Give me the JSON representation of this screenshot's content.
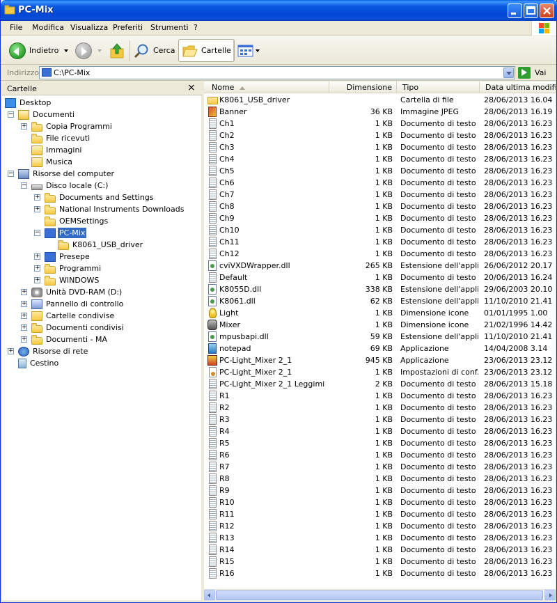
{
  "window": {
    "title": "PC-Mix"
  },
  "menu": [
    "File",
    "Modifica",
    "Visualizza",
    "Preferiti",
    "Strumenti",
    "?"
  ],
  "toolbar": {
    "back_label": "Indietro",
    "search_label": "Cerca",
    "folders_label": "Cartelle"
  },
  "address": {
    "label": "Indirizzo",
    "value": "C:\\PC-Mix",
    "go_label": "Vai"
  },
  "folders_pane": {
    "title": "Cartelle",
    "close_glyph": "×",
    "tree": [
      {
        "label": "Desktop",
        "icon": "desktop-icon",
        "depth": 0,
        "expander": ""
      },
      {
        "label": "Documenti",
        "icon": "documents-icon",
        "depth": 1,
        "expander": "−"
      },
      {
        "label": "Copia Programmi",
        "icon": "folder-icon",
        "depth": 2,
        "expander": "+"
      },
      {
        "label": "File ricevuti",
        "icon": "folder-icon",
        "depth": 2,
        "expander": ""
      },
      {
        "label": "Immagini",
        "icon": "documents-icon",
        "depth": 2,
        "expander": ""
      },
      {
        "label": "Musica",
        "icon": "documents-icon",
        "depth": 2,
        "expander": ""
      },
      {
        "label": "Risorse del computer",
        "icon": "computer-icon",
        "depth": 1,
        "expander": "−"
      },
      {
        "label": "Disco locale (C:)",
        "icon": "drive-icon",
        "depth": 2,
        "expander": "−"
      },
      {
        "label": "Documents and Settings",
        "icon": "folder-icon",
        "depth": 3,
        "expander": "+"
      },
      {
        "label": "National Instruments Downloads",
        "icon": "folder-icon",
        "depth": 3,
        "expander": "+"
      },
      {
        "label": "OEMSettings",
        "icon": "folder-icon",
        "depth": 3,
        "expander": ""
      },
      {
        "label": "PC-Mix",
        "icon": "pcmix-folder-icon",
        "depth": 3,
        "expander": "−",
        "selected": true
      },
      {
        "label": "K8061_USB_driver",
        "icon": "folder-icon",
        "depth": 4,
        "expander": ""
      },
      {
        "label": "Presepe",
        "icon": "pcmix-folder-icon",
        "depth": 3,
        "expander": "+"
      },
      {
        "label": "Programmi",
        "icon": "folder-icon",
        "depth": 3,
        "expander": "+"
      },
      {
        "label": "WINDOWS",
        "icon": "folder-icon",
        "depth": 3,
        "expander": "+"
      },
      {
        "label": "Unità DVD-RAM (D:)",
        "icon": "dvd-icon",
        "depth": 2,
        "expander": "+"
      },
      {
        "label": "Pannello di controllo",
        "icon": "control-panel-icon",
        "depth": 2,
        "expander": "+"
      },
      {
        "label": "Cartelle condivise",
        "icon": "shared-folders-icon",
        "depth": 2,
        "expander": "+"
      },
      {
        "label": "Documenti condivisi",
        "icon": "folder-icon",
        "depth": 2,
        "expander": "+"
      },
      {
        "label": "Documenti - MA",
        "icon": "folder-icon",
        "depth": 2,
        "expander": "+"
      },
      {
        "label": "Risorse di rete",
        "icon": "network-icon",
        "depth": 1,
        "expander": "+"
      },
      {
        "label": "Cestino",
        "icon": "recycle-bin-icon",
        "depth": 1,
        "expander": ""
      }
    ]
  },
  "files_pane": {
    "columns": [
      "Nome",
      "Dimensione",
      "Tipo",
      "Data ultima modifica"
    ],
    "files": [
      {
        "name": "K8061_USB_driver",
        "size": "",
        "type": "Cartella di file",
        "date": "28/06/2013 16.04",
        "icon": "folder"
      },
      {
        "name": "Banner",
        "size": "36 KB",
        "type": "Immagine JPEG",
        "date": "28/06/2013 16.19",
        "icon": "jpg"
      },
      {
        "name": "Ch1",
        "size": "1 KB",
        "type": "Documento di testo",
        "date": "28/06/2013 16.23",
        "icon": "text"
      },
      {
        "name": "Ch2",
        "size": "1 KB",
        "type": "Documento di testo",
        "date": "28/06/2013 16.23",
        "icon": "text"
      },
      {
        "name": "Ch3",
        "size": "1 KB",
        "type": "Documento di testo",
        "date": "28/06/2013 16.23",
        "icon": "text"
      },
      {
        "name": "Ch4",
        "size": "1 KB",
        "type": "Documento di testo",
        "date": "28/06/2013 16.23",
        "icon": "text"
      },
      {
        "name": "Ch5",
        "size": "1 KB",
        "type": "Documento di testo",
        "date": "28/06/2013 16.23",
        "icon": "text"
      },
      {
        "name": "Ch6",
        "size": "1 KB",
        "type": "Documento di testo",
        "date": "28/06/2013 16.23",
        "icon": "text"
      },
      {
        "name": "Ch7",
        "size": "1 KB",
        "type": "Documento di testo",
        "date": "28/06/2013 16.23",
        "icon": "text"
      },
      {
        "name": "Ch8",
        "size": "1 KB",
        "type": "Documento di testo",
        "date": "28/06/2013 16.23",
        "icon": "text"
      },
      {
        "name": "Ch9",
        "size": "1 KB",
        "type": "Documento di testo",
        "date": "28/06/2013 16.23",
        "icon": "text"
      },
      {
        "name": "Ch10",
        "size": "1 KB",
        "type": "Documento di testo",
        "date": "28/06/2013 16.23",
        "icon": "text"
      },
      {
        "name": "Ch11",
        "size": "1 KB",
        "type": "Documento di testo",
        "date": "28/06/2013 16.23",
        "icon": "text"
      },
      {
        "name": "Ch12",
        "size": "1 KB",
        "type": "Documento di testo",
        "date": "28/06/2013 16.23",
        "icon": "text"
      },
      {
        "name": "cviVXDWrapper.dll",
        "size": "265 KB",
        "type": "Estensione dell'appli...",
        "date": "26/06/2012 20.17",
        "icon": "dll"
      },
      {
        "name": "Default",
        "size": "1 KB",
        "type": "Documento di testo",
        "date": "20/06/2013 16.24",
        "icon": "text"
      },
      {
        "name": "K8055D.dll",
        "size": "338 KB",
        "type": "Estensione dell'appli...",
        "date": "29/06/2003 20.10",
        "icon": "dll"
      },
      {
        "name": "K8061.dll",
        "size": "62 KB",
        "type": "Estensione dell'appli...",
        "date": "11/10/2010 21.41",
        "icon": "dll"
      },
      {
        "name": "Light",
        "size": "1 KB",
        "type": "Dimensione icone",
        "date": "01/01/1995 1.00",
        "icon": "bulb"
      },
      {
        "name": "Mixer",
        "size": "1 KB",
        "type": "Dimensione icone",
        "date": "21/02/1996 14.42",
        "icon": "mixer"
      },
      {
        "name": "mpusbapi.dll",
        "size": "59 KB",
        "type": "Estensione dell'appli...",
        "date": "11/10/2010 21.41",
        "icon": "dll"
      },
      {
        "name": "notepad",
        "size": "69 KB",
        "type": "Applicazione",
        "date": "14/04/2008 3.14",
        "icon": "notepad"
      },
      {
        "name": "PC-Light_Mixer 2_1",
        "size": "945 KB",
        "type": "Applicazione",
        "date": "23/06/2013 23.12",
        "icon": "exe"
      },
      {
        "name": "PC-Light_Mixer 2_1",
        "size": "1 KB",
        "type": "Impostazioni di conf...",
        "date": "23/06/2013 23.12",
        "icon": "ini"
      },
      {
        "name": "PC-Light_Mixer 2_1 Leggimi",
        "size": "2 KB",
        "type": "Documento di testo",
        "date": "28/06/2013 15.18",
        "icon": "text"
      },
      {
        "name": "R1",
        "size": "1 KB",
        "type": "Documento di testo",
        "date": "28/06/2013 16.23",
        "icon": "text"
      },
      {
        "name": "R2",
        "size": "1 KB",
        "type": "Documento di testo",
        "date": "28/06/2013 16.23",
        "icon": "text"
      },
      {
        "name": "R3",
        "size": "1 KB",
        "type": "Documento di testo",
        "date": "28/06/2013 16.23",
        "icon": "text"
      },
      {
        "name": "R4",
        "size": "1 KB",
        "type": "Documento di testo",
        "date": "28/06/2013 16.23",
        "icon": "text"
      },
      {
        "name": "R5",
        "size": "1 KB",
        "type": "Documento di testo",
        "date": "28/06/2013 16.23",
        "icon": "text"
      },
      {
        "name": "R6",
        "size": "1 KB",
        "type": "Documento di testo",
        "date": "28/06/2013 16.23",
        "icon": "text"
      },
      {
        "name": "R7",
        "size": "1 KB",
        "type": "Documento di testo",
        "date": "28/06/2013 16.23",
        "icon": "text"
      },
      {
        "name": "R8",
        "size": "1 KB",
        "type": "Documento di testo",
        "date": "28/06/2013 16.23",
        "icon": "text"
      },
      {
        "name": "R9",
        "size": "1 KB",
        "type": "Documento di testo",
        "date": "28/06/2013 16.23",
        "icon": "text"
      },
      {
        "name": "R10",
        "size": "1 KB",
        "type": "Documento di testo",
        "date": "28/06/2013 16.23",
        "icon": "text"
      },
      {
        "name": "R11",
        "size": "1 KB",
        "type": "Documento di testo",
        "date": "28/06/2013 16.23",
        "icon": "text"
      },
      {
        "name": "R12",
        "size": "1 KB",
        "type": "Documento di testo",
        "date": "28/06/2013 16.23",
        "icon": "text"
      },
      {
        "name": "R13",
        "size": "1 KB",
        "type": "Documento di testo",
        "date": "28/06/2013 16.23",
        "icon": "text"
      },
      {
        "name": "R14",
        "size": "1 KB",
        "type": "Documento di testo",
        "date": "28/06/2013 16.23",
        "icon": "text"
      },
      {
        "name": "R15",
        "size": "1 KB",
        "type": "Documento di testo",
        "date": "28/06/2013 16.23",
        "icon": "text"
      },
      {
        "name": "R16",
        "size": "1 KB",
        "type": "Documento di testo",
        "date": "28/06/2013 16.23",
        "icon": "text"
      }
    ]
  },
  "colors": {
    "titlebar": "#0054e3",
    "selection": "#316ac5",
    "chrome": "#ece9d8"
  }
}
